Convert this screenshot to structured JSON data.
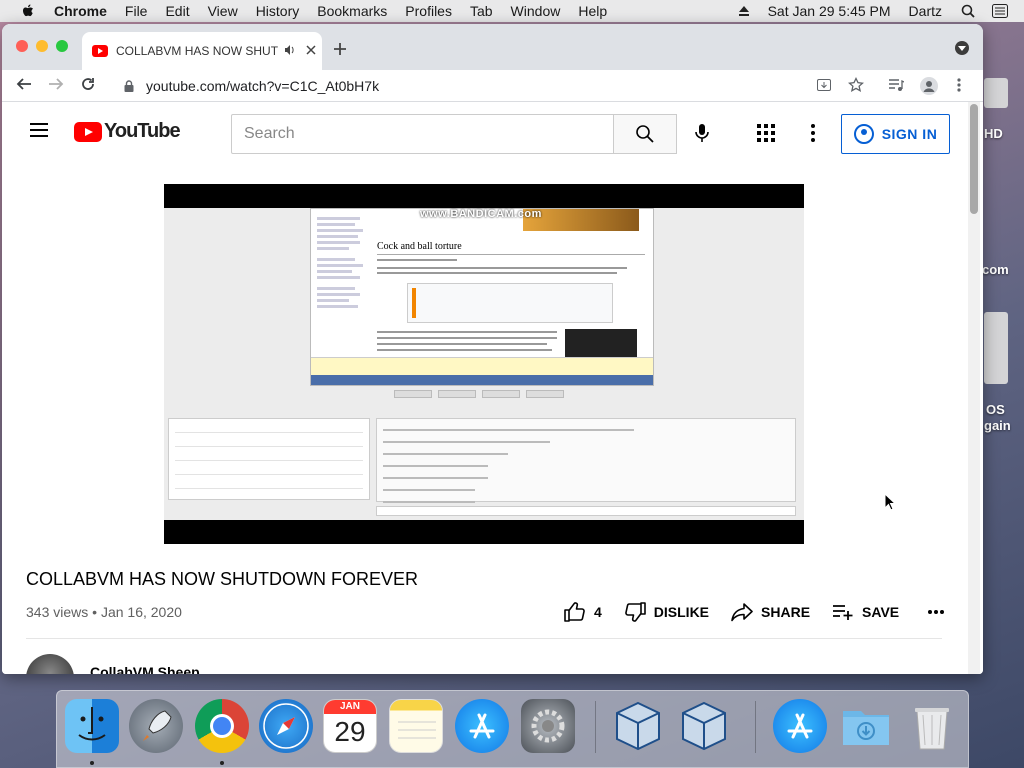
{
  "menubar": {
    "app_name": "Chrome",
    "items": [
      "File",
      "Edit",
      "View",
      "History",
      "Bookmarks",
      "Profiles",
      "Tab",
      "Window",
      "Help"
    ],
    "clock": "Sat Jan 29  5:45 PM",
    "user": "Dartz"
  },
  "desktop": {
    "labels": [
      "HD",
      "com",
      "OS",
      "gain"
    ]
  },
  "browser": {
    "tab_title": "COLLABVM HAS NOW SHUTDOWN FOREVER",
    "url": "youtube.com/watch?v=C1C_At0bH7k"
  },
  "youtube": {
    "logo_text": "YouTube",
    "search_placeholder": "Search",
    "sign_in_label": "SIGN IN",
    "video": {
      "watermark": "www.BANDICAM.com",
      "embedded_article_title": "Cock and ball torture"
    },
    "title": "COLLABVM HAS NOW SHUTDOWN FOREVER",
    "views": "343 views",
    "date": "Jan 16, 2020",
    "likes": "4",
    "dislike_label": "DISLIKE",
    "share_label": "SHARE",
    "save_label": "SAVE",
    "channel_name": "CollabVM Sheep"
  },
  "dock": {
    "apps": [
      "Finder",
      "Launchpad",
      "Google Chrome",
      "Safari",
      "Calendar",
      "Notes",
      "App Store",
      "System Preferences",
      "VirtualBox",
      "VirtualBox",
      "App Store",
      "Downloads",
      "Trash"
    ],
    "calendar_month": "JAN",
    "calendar_day": "29"
  },
  "colors": {
    "youtube_red": "#ff0000",
    "link_blue": "#065fd4"
  }
}
